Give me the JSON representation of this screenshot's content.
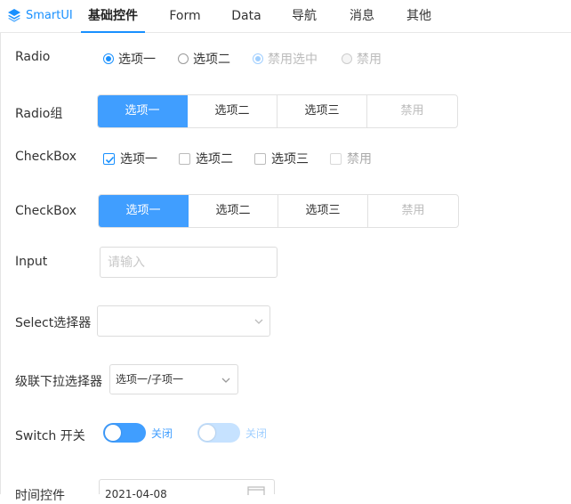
{
  "brand": {
    "name": "SmartUI",
    "icon": "layers-icon"
  },
  "nav": {
    "tabs": [
      {
        "label": "基础控件",
        "active": true
      },
      {
        "label": "Form"
      },
      {
        "label": "Data"
      },
      {
        "label": "导航"
      },
      {
        "label": "消息"
      },
      {
        "label": "其他"
      }
    ]
  },
  "radio": {
    "label": "Radio",
    "options": [
      "选项一",
      "选项二",
      "禁用选中",
      "禁用"
    ]
  },
  "radio_group": {
    "label": "Radio组",
    "options": [
      "选项一",
      "选项二",
      "选项三",
      "禁用"
    ]
  },
  "checkbox": {
    "label": "CheckBox",
    "options": [
      "选项一",
      "选项二",
      "选项三",
      "禁用"
    ]
  },
  "checkbox_group": {
    "label": "CheckBox",
    "options": [
      "选项一",
      "选项二",
      "选项三",
      "禁用"
    ]
  },
  "input": {
    "label": "Input",
    "placeholder": "请输入",
    "value": ""
  },
  "select": {
    "label": "Select选择器",
    "value": ""
  },
  "cascader": {
    "label": "级联下拉选择器",
    "value": "选项一/子项一"
  },
  "switch": {
    "label": "Switch 开关",
    "state_text": "关闭",
    "disabled_state_text": "关闭"
  },
  "time": {
    "label": "时间控件",
    "value": "2021-04-08"
  },
  "colors": {
    "primary": "#409eff",
    "brand": "#1890ff"
  }
}
